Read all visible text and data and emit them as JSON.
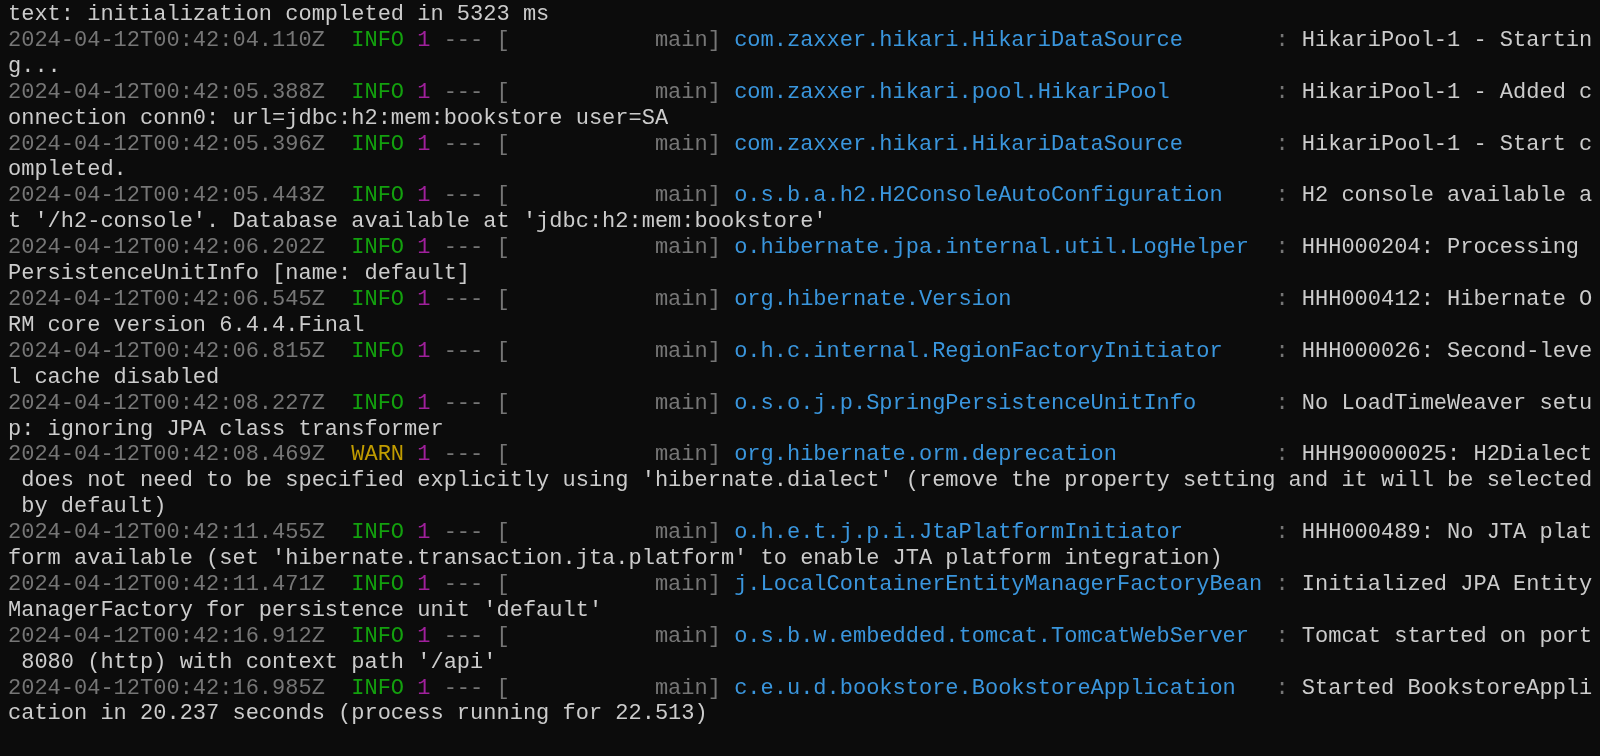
{
  "terminal": {
    "lines": [
      {
        "kind": "text",
        "text": "text: initialization completed in 5323 ms"
      },
      {
        "kind": "log",
        "timestamp": "2024-04-12T00:42:04.110Z",
        "level": "INFO",
        "color": "#13a10e",
        "pid": "1",
        "separator": "---",
        "bracket": "[",
        "thread": "main]",
        "logger": "com.zaxxer.hikari.HikariDataSource",
        "colon": ":",
        "message_lines": [
          "HikariPool-1 - Startin",
          "g..."
        ]
      },
      {
        "kind": "log",
        "timestamp": "2024-04-12T00:42:05.388Z",
        "level": "INFO",
        "color": "#13a10e",
        "pid": "1",
        "separator": "---",
        "bracket": "[",
        "thread": "main]",
        "logger": "com.zaxxer.hikari.pool.HikariPool",
        "colon": ":",
        "message_lines": [
          "HikariPool-1 - Added c",
          "onnection conn0: url=jdbc:h2:mem:bookstore user=SA"
        ]
      },
      {
        "kind": "log",
        "timestamp": "2024-04-12T00:42:05.396Z",
        "level": "INFO",
        "color": "#13a10e",
        "pid": "1",
        "separator": "---",
        "bracket": "[",
        "thread": "main]",
        "logger": "com.zaxxer.hikari.HikariDataSource",
        "colon": ":",
        "message_lines": [
          "HikariPool-1 - Start c",
          "ompleted."
        ]
      },
      {
        "kind": "log",
        "timestamp": "2024-04-12T00:42:05.443Z",
        "level": "INFO",
        "color": "#13a10e",
        "pid": "1",
        "separator": "---",
        "bracket": "[",
        "thread": "main]",
        "logger": "o.s.b.a.h2.H2ConsoleAutoConfiguration",
        "colon": ":",
        "message_lines": [
          "H2 console available a",
          "t '/h2-console'. Database available at 'jdbc:h2:mem:bookstore'"
        ]
      },
      {
        "kind": "log",
        "timestamp": "2024-04-12T00:42:06.202Z",
        "level": "INFO",
        "color": "#13a10e",
        "pid": "1",
        "separator": "---",
        "bracket": "[",
        "thread": "main]",
        "logger": "o.hibernate.jpa.internal.util.LogHelper",
        "colon": ":",
        "message_lines": [
          "HHH000204: Processing",
          "PersistenceUnitInfo [name: default]"
        ]
      },
      {
        "kind": "log",
        "timestamp": "2024-04-12T00:42:06.545Z",
        "level": "INFO",
        "color": "#13a10e",
        "pid": "1",
        "separator": "---",
        "bracket": "[",
        "thread": "main]",
        "logger": "org.hibernate.Version",
        "colon": ":",
        "message_lines": [
          "HHH000412: Hibernate O",
          "RM core version 6.4.4.Final"
        ]
      },
      {
        "kind": "log",
        "timestamp": "2024-04-12T00:42:06.815Z",
        "level": "INFO",
        "color": "#13a10e",
        "pid": "1",
        "separator": "---",
        "bracket": "[",
        "thread": "main]",
        "logger": "o.h.c.internal.RegionFactoryInitiator",
        "colon": ":",
        "message_lines": [
          "HHH000026: Second-leve",
          "l cache disabled"
        ]
      },
      {
        "kind": "log",
        "timestamp": "2024-04-12T00:42:08.227Z",
        "level": "INFO",
        "color": "#13a10e",
        "pid": "1",
        "separator": "---",
        "bracket": "[",
        "thread": "main]",
        "logger": "o.s.o.j.p.SpringPersistenceUnitInfo",
        "colon": ":",
        "message_lines": [
          "No LoadTimeWeaver setu",
          "p: ignoring JPA class transformer"
        ]
      },
      {
        "kind": "log",
        "timestamp": "2024-04-12T00:42:08.469Z",
        "level": "WARN",
        "color": "#c19c00",
        "pid": "1",
        "separator": "---",
        "bracket": "[",
        "thread": "main]",
        "logger": "org.hibernate.orm.deprecation",
        "colon": ":",
        "message_lines": [
          "HHH90000025: H2Dialect",
          " does not need to be specified explicitly using 'hibernate.dialect' (remove the property setting and it will be selected",
          " by default)"
        ]
      },
      {
        "kind": "log",
        "timestamp": "2024-04-12T00:42:11.455Z",
        "level": "INFO",
        "color": "#13a10e",
        "pid": "1",
        "separator": "---",
        "bracket": "[",
        "thread": "main]",
        "logger": "o.h.e.t.j.p.i.JtaPlatformInitiator",
        "colon": ":",
        "message_lines": [
          "HHH000489: No JTA plat",
          "form available (set 'hibernate.transaction.jta.platform' to enable JTA platform integration)"
        ]
      },
      {
        "kind": "log",
        "timestamp": "2024-04-12T00:42:11.471Z",
        "level": "INFO",
        "color": "#13a10e",
        "pid": "1",
        "separator": "---",
        "bracket": "[",
        "thread": "main]",
        "logger": "j.LocalContainerEntityManagerFactoryBean",
        "colon": ":",
        "message_lines": [
          "Initialized JPA Entity",
          "ManagerFactory for persistence unit 'default'"
        ]
      },
      {
        "kind": "log",
        "timestamp": "2024-04-12T00:42:16.912Z",
        "level": "INFO",
        "color": "#13a10e",
        "pid": "1",
        "separator": "---",
        "bracket": "[",
        "thread": "main]",
        "logger": "o.s.b.w.embedded.tomcat.TomcatWebServer",
        "colon": ":",
        "message_lines": [
          "Tomcat started on port",
          " 8080 (http) with context path '/api'"
        ]
      },
      {
        "kind": "log",
        "timestamp": "2024-04-12T00:42:16.985Z",
        "level": "INFO",
        "color": "#13a10e",
        "pid": "1",
        "separator": "---",
        "bracket": "[",
        "thread": "main]",
        "logger": "c.e.u.d.bookstore.BookstoreApplication",
        "colon": ":",
        "message_lines": [
          "Started BookstoreAppli",
          "cation in 20.237 seconds (process running for 22.513)"
        ]
      }
    ]
  }
}
